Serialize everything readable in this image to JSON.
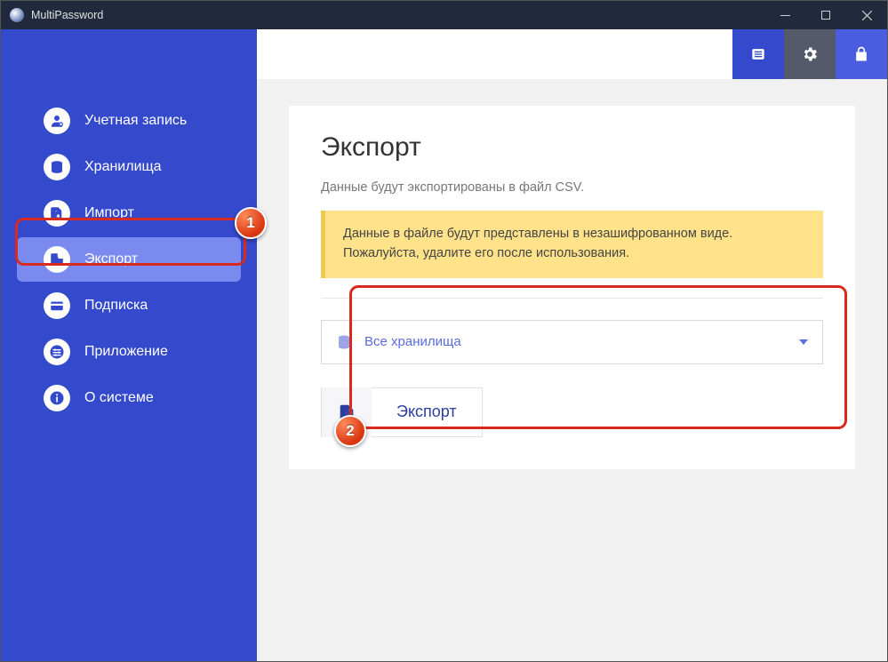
{
  "window": {
    "title": "MultiPassword"
  },
  "sidebar": {
    "items": [
      {
        "label": "Учетная запись"
      },
      {
        "label": "Хранилища"
      },
      {
        "label": "Импорт"
      },
      {
        "label": "Экспорт"
      },
      {
        "label": "Подписка"
      },
      {
        "label": "Приложение"
      },
      {
        "label": "О системе"
      }
    ]
  },
  "main": {
    "title": "Экспорт",
    "subtitle": "Данные будут экспортированы в файл CSV.",
    "warning": "Данные в файле будут представлены в незашифрованном виде. Пожалуйста, удалите его после использования.",
    "select_label": "Все хранилища",
    "export_button": "Экспорт"
  },
  "annotations": {
    "badge1": "1",
    "badge2": "2"
  }
}
